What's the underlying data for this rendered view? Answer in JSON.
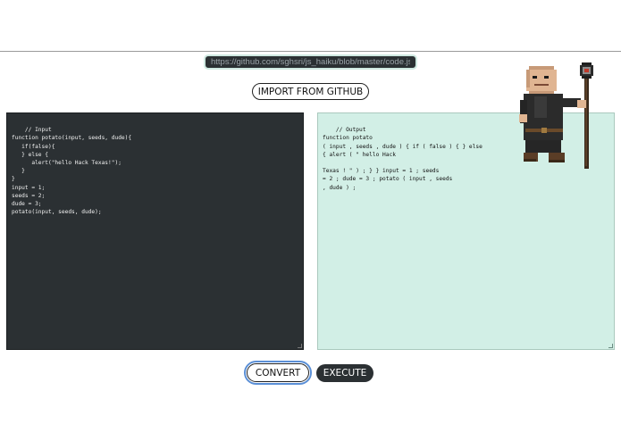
{
  "github_url": {
    "value": "https://github.com/sghsri/js_haiku/blob/master/code.js"
  },
  "import_button_label": "IMPORT FROM GITHUB",
  "input_code": "// Input\nfunction potato(input, seeds, dude){\n   if(false){\n   } else {\n      alert(\"hello Hack Texas!\");\n   }\n}\ninput = 1;\nseeds = 2;\ndude = 3;\npotato(input, seeds, dude);",
  "output_code": "// Output\nfunction potato\n( input , seeds , dude ) { if ( false ) { } else\n{ alert ( \" hello Hack\n\nTexas ! \" ) ; } } input = 1 ; seeds\n= 2 ; dude = 3 ; potato ( input , seeds\n, dude ) ;",
  "convert_button_label": "CONVERT",
  "execute_button_label": "EXECUTE",
  "colors": {
    "dark": "#2b3033",
    "mint": "#d2efe6",
    "focus": "#5a8fd6"
  },
  "icons": {
    "mascot": "pixel-wizard-with-staff-icon"
  }
}
